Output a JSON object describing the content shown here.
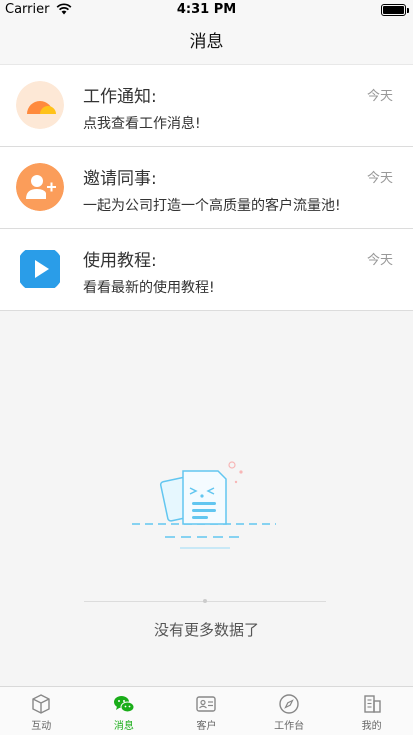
{
  "status_bar": {
    "carrier": "Carrier",
    "time": "4:31 PM"
  },
  "nav": {
    "title": "消息"
  },
  "rows": [
    {
      "name": "工作通知:",
      "message": "点我查看工作消息!",
      "time": "今天",
      "icon": "sun-icon",
      "color": "#ff8a3d"
    },
    {
      "name": "邀请同事:",
      "message": "一起为公司打造一个高质量的客户流量池!",
      "time": "今天",
      "icon": "add-user-icon",
      "color": "#fb9d5a"
    },
    {
      "name": "使用教程:",
      "message": "看看最新的使用教程!",
      "time": "今天",
      "icon": "play-icon",
      "color": "#2a9de8"
    }
  ],
  "empty": {
    "end_text": "没有更多数据了"
  },
  "tabs": [
    {
      "label": "互动",
      "icon": "box-icon",
      "active": false
    },
    {
      "label": "消息",
      "icon": "chat-icon",
      "active": true
    },
    {
      "label": "客户",
      "icon": "contact-card-icon",
      "active": false
    },
    {
      "label": "工作台",
      "icon": "compass-icon",
      "active": false
    },
    {
      "label": "我的",
      "icon": "building-icon",
      "active": false
    }
  ],
  "colors": {
    "accent": "#1aad19",
    "inactive": "#666666"
  }
}
